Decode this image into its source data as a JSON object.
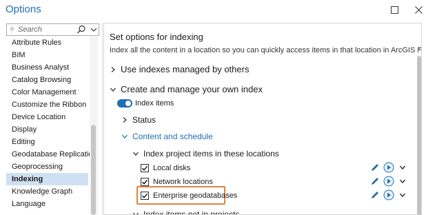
{
  "window": {
    "title": "Options"
  },
  "search": {
    "placeholder": "Search"
  },
  "sidebar": {
    "items": [
      {
        "label": "Attribute Rules"
      },
      {
        "label": "BIM"
      },
      {
        "label": "Business Analyst"
      },
      {
        "label": "Catalog Browsing"
      },
      {
        "label": "Color Management"
      },
      {
        "label": "Customize the Ribbon"
      },
      {
        "label": "Device Location"
      },
      {
        "label": "Display"
      },
      {
        "label": "Editing"
      },
      {
        "label": "Geodatabase Replication"
      },
      {
        "label": "Geoprocessing"
      },
      {
        "label": "Indexing",
        "selected": true
      },
      {
        "label": "Knowledge Graph"
      },
      {
        "label": "Language"
      }
    ]
  },
  "main": {
    "title": "Set options for indexing",
    "description": "Index all the content in a location so you can quickly access items in that location in ArcGIS Pro.",
    "use_indexes": "Use indexes managed by others",
    "create_manage": "Create and manage your own index",
    "index_items_toggle": {
      "label": "Index items",
      "on": true
    },
    "status": "Status",
    "content_schedule": "Content and schedule",
    "index_project_items": "Index project items in these locations",
    "locations": [
      {
        "label": "Local disks",
        "checked": true
      },
      {
        "label": "Network locations",
        "checked": true
      },
      {
        "label": "Enterprise geodatabases",
        "checked": true,
        "highlighted": true
      }
    ],
    "index_not_in_projects": "Index items not in projects"
  },
  "colors": {
    "accent": "#1e6fb3",
    "highlight": "#e0833b",
    "selected_bg": "#cfe0f2"
  }
}
